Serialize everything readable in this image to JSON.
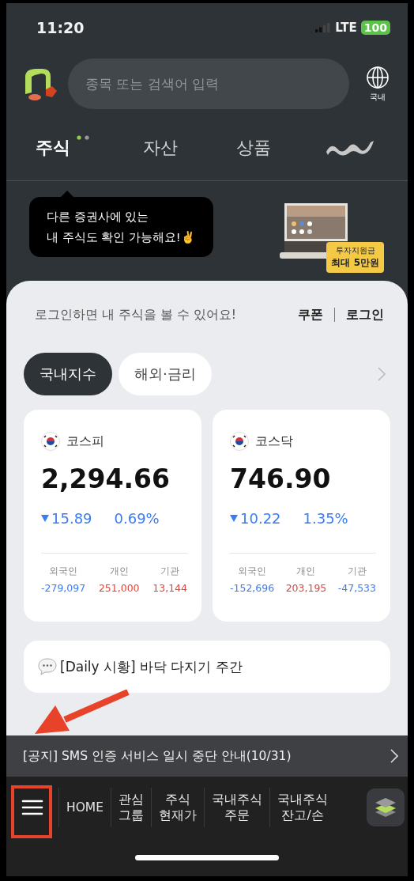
{
  "status_bar": {
    "time": "11:20",
    "network": "LTE",
    "battery": "100"
  },
  "header": {
    "search": {
      "placeholder": "종목 또는 검색어 입력"
    },
    "region_label": "국내"
  },
  "tabs": [
    {
      "kind": "text",
      "label": "주식",
      "selected": true
    },
    {
      "kind": "text",
      "label": "자산",
      "selected": false
    },
    {
      "kind": "text",
      "label": "상품",
      "selected": false
    },
    {
      "kind": "logo",
      "selected": false
    }
  ],
  "tooltip": {
    "text": "다른 증권사에 있는\n내 주식도 확인 가능해요!✌️"
  },
  "promo": {
    "kind": "picture",
    "badge_caption": "투자지원금",
    "badge_amount": "최대 5만원"
  },
  "login_prompt": {
    "message": "로그인하면 내 주식을 볼 수 있어요!",
    "links": [
      "쿠폰",
      "로그인"
    ]
  },
  "index_tabs": [
    {
      "label": "국내지수",
      "selected": true
    },
    {
      "label": "해외·금리",
      "selected": false
    }
  ],
  "indices": [
    {
      "name": "코스피",
      "value": "2,294.66",
      "change": "15.89",
      "change_percent": "0.69%",
      "falling": true,
      "flows": [
        {
          "label": "외국인",
          "value": "-279,097",
          "falling": true
        },
        {
          "label": "개인",
          "value": "251,000",
          "falling": false
        },
        {
          "label": "기관",
          "value": "13,144",
          "falling": false
        }
      ]
    },
    {
      "name": "코스닥",
      "value": "746.90",
      "change": "10.22",
      "change_percent": "1.35%",
      "falling": true,
      "flows": [
        {
          "label": "외국인",
          "value": "-152,696",
          "falling": true
        },
        {
          "label": "개인",
          "value": "203,195",
          "falling": false
        },
        {
          "label": "기관",
          "value": "-47,533",
          "falling": true
        }
      ]
    }
  ],
  "news": {
    "text": "[Daily 시황] 바닥 다지기 주간"
  },
  "notice": {
    "text": "[공지] SMS 인증 서비스 일시 중단 안내(10/31)"
  },
  "bottom_nav": [
    {
      "kind": "menu"
    },
    {
      "kind": "text",
      "label": "HOME"
    },
    {
      "kind": "text",
      "label": "관심\n그룹"
    },
    {
      "kind": "text",
      "label": "주식\n현재가"
    },
    {
      "kind": "text",
      "label": "국내주식\n주문"
    },
    {
      "kind": "text",
      "label": "국내주식\n잔고/손"
    },
    {
      "kind": "layers"
    }
  ],
  "annotations": {
    "highlight_box": true,
    "arrow": true
  }
}
